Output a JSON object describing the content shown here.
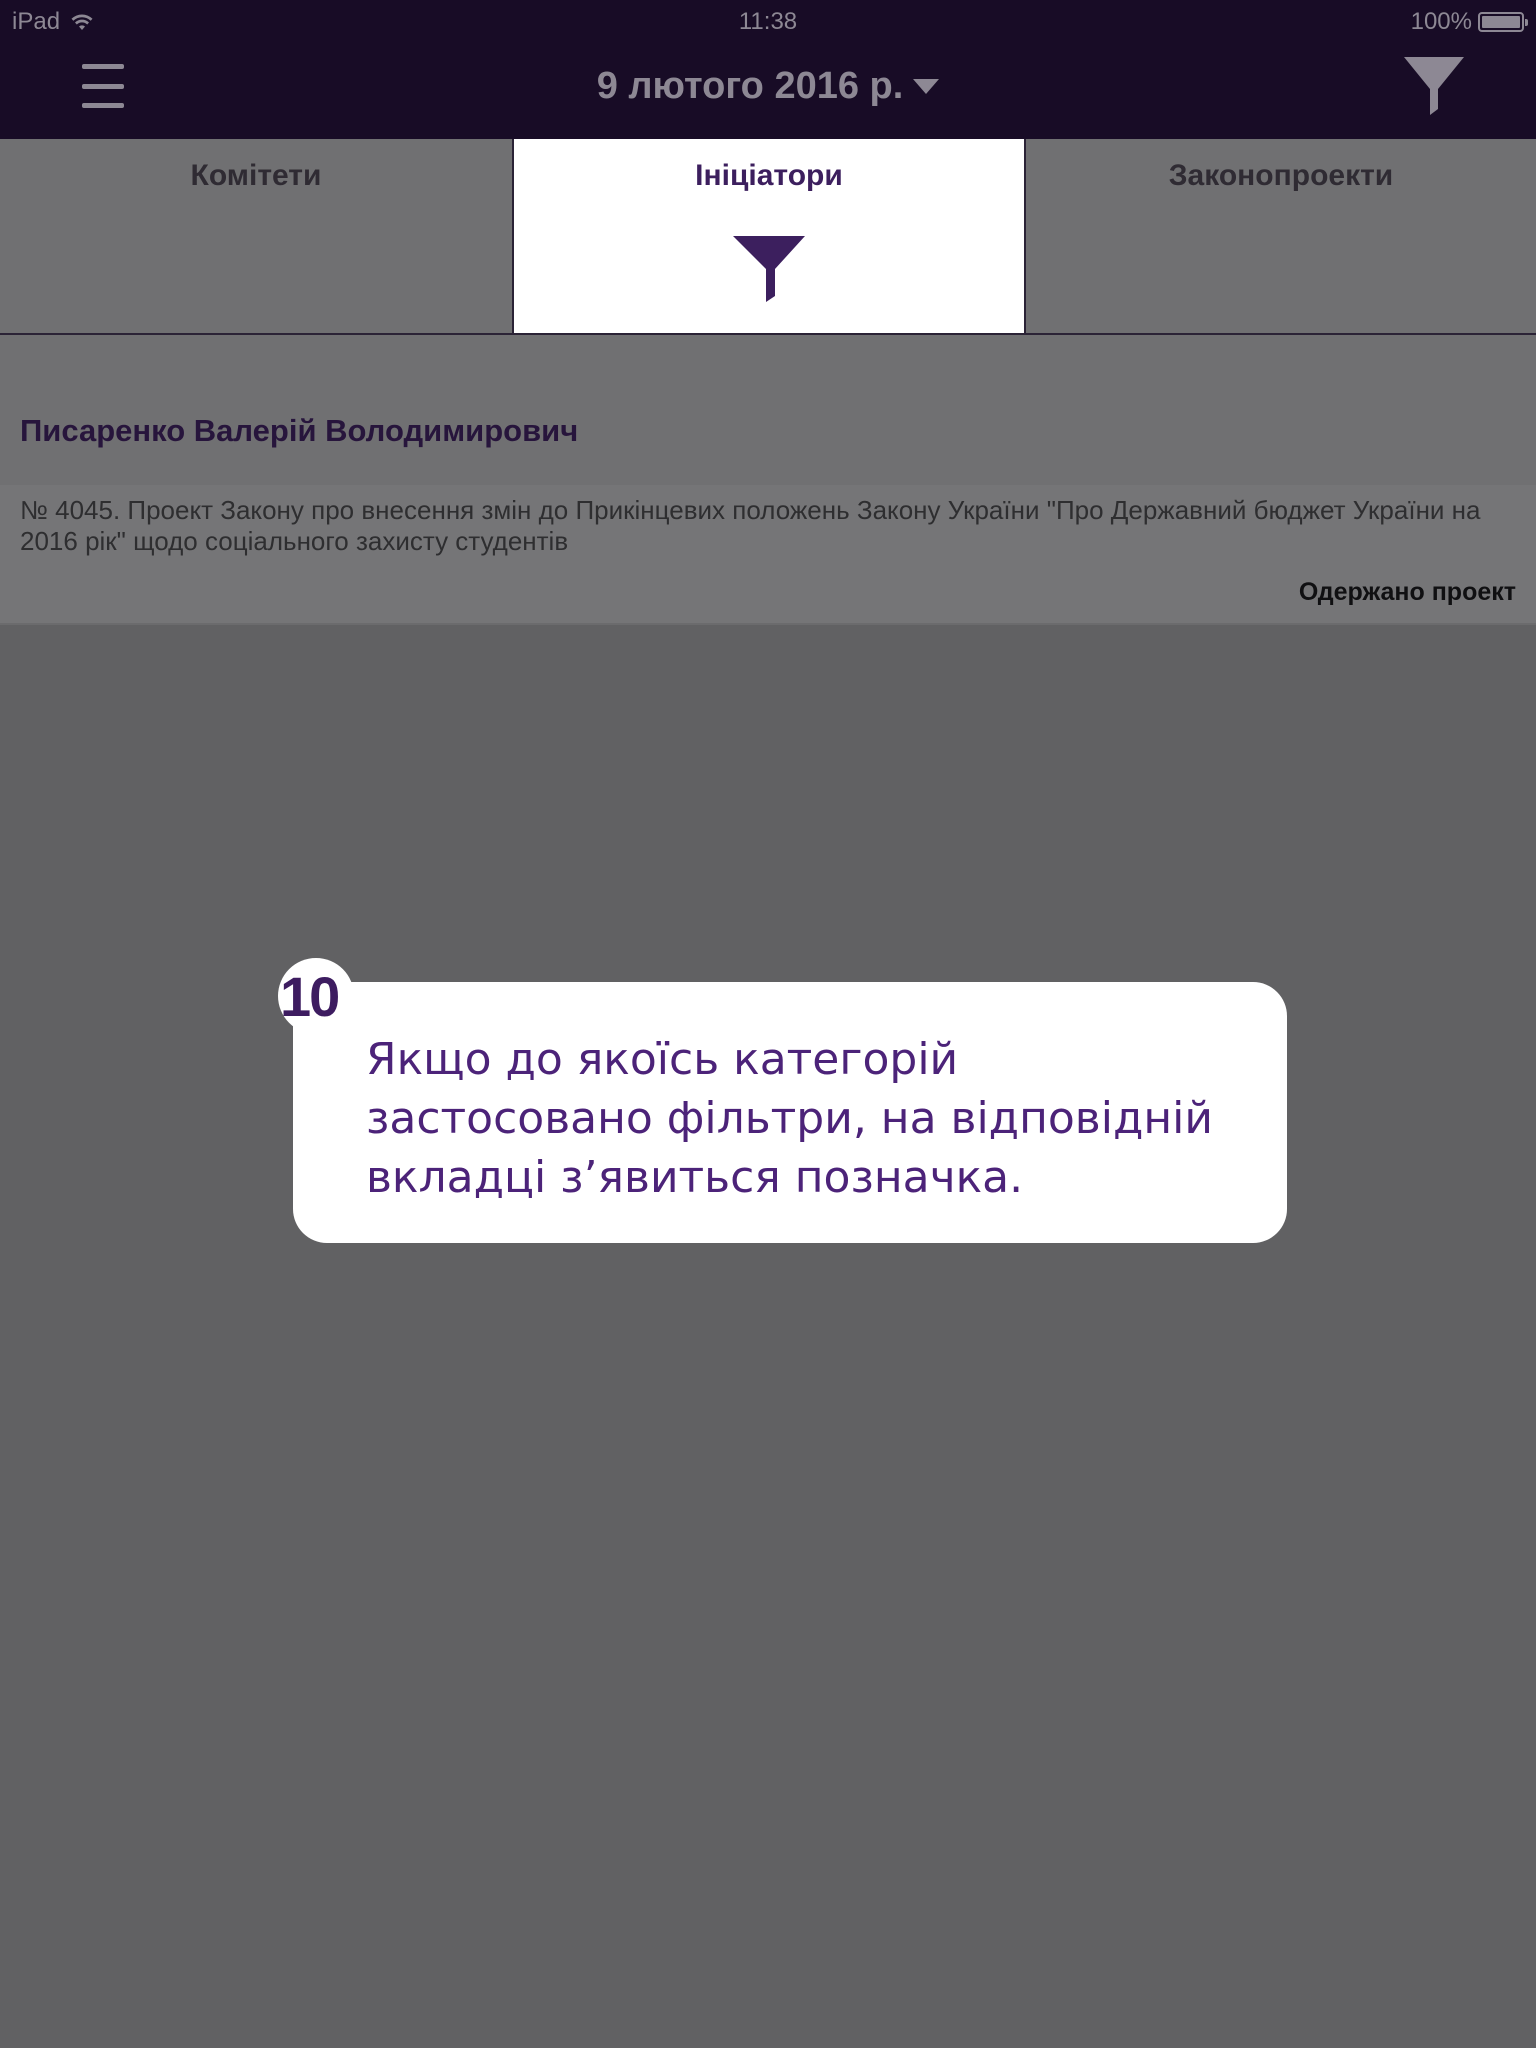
{
  "status_bar": {
    "device": "iPad",
    "time": "11:38",
    "battery": "100%"
  },
  "nav": {
    "date": "9 лютого 2016 р.",
    "menu_icon": "hamburger-menu-icon",
    "filter_icon": "funnel-filter-icon"
  },
  "tabs": [
    {
      "label": "Комітети",
      "active": false
    },
    {
      "label": "Ініціатори",
      "active": true,
      "filter_applied": true
    },
    {
      "label": "Законопроекти",
      "active": false
    }
  ],
  "list": {
    "section_header": "Писаренко Валерій Володимирович",
    "items": [
      {
        "title": "№ 4045. Проект Закону про внесення змін до Прикінцевих положень Закону України \"Про Державний бюджет України на 2016 рік\" щодо соціального захисту студентів",
        "status": "Одержано проект"
      }
    ]
  },
  "tutorial": {
    "step": "10",
    "text": "Якщо до якоїсь категорій застосовано фільтри, на відповідній вкладці з’явиться позначка."
  },
  "colors": {
    "nav_bg": "#180c26",
    "accent": "#4c2379",
    "overlay": "#616163"
  }
}
